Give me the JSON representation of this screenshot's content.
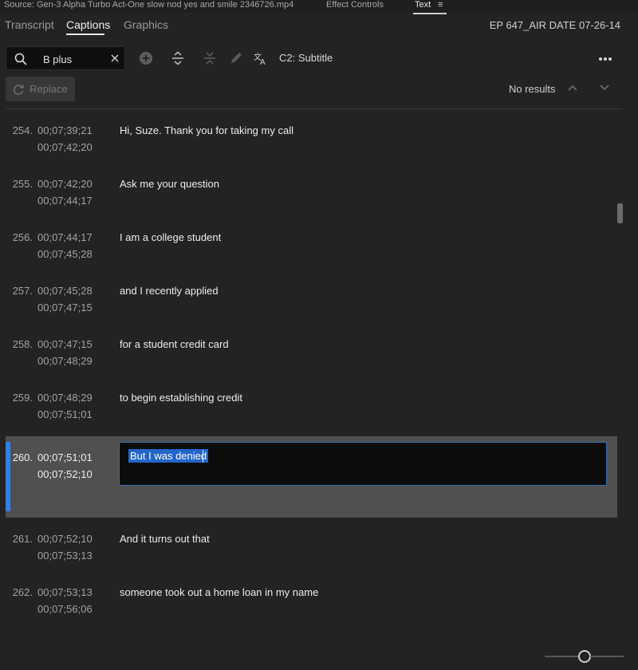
{
  "topbar": {
    "source": "Source: Gen-3 Alpha Turbo Act-One slow nod yes and smile 2346726.mp4",
    "effect_controls": "Effect Controls",
    "text_tab": "Text",
    "menu_glyph": "≡"
  },
  "tabs": [
    {
      "label": "Transcript"
    },
    {
      "label": "Captions",
      "active": true
    },
    {
      "label": "Graphics"
    }
  ],
  "sequence_title": "EP 647_AIR DATE 07-26-14",
  "toolbar": {
    "search_value": "B plus",
    "track_label": "C2: Subtitle",
    "icons": [
      "search-icon",
      "clear-icon",
      "add-caption-icon",
      "split-caption-icon",
      "merge-captions-icon",
      "pencil-icon",
      "translate-icon",
      "more-icon"
    ]
  },
  "replace": {
    "label": "Replace"
  },
  "results": {
    "label": "No results"
  },
  "captions": [
    {
      "num": "254.",
      "in": "00;07;39;21",
      "out": "00;07;42;20",
      "text": "Hi, Suze. Thank you for taking my call"
    },
    {
      "num": "255.",
      "in": "00;07;42;20",
      "out": "00;07;44;17",
      "text": "Ask me your question"
    },
    {
      "num": "256.",
      "in": "00;07;44;17",
      "out": "00;07;45;28",
      "text": "I am a college student"
    },
    {
      "num": "257.",
      "in": "00;07;45;28",
      "out": "00;07;47;15",
      "text": "and I recently applied"
    },
    {
      "num": "258.",
      "in": "00;07;47;15",
      "out": "00;07;48;29",
      "text": "for a student credit card"
    },
    {
      "num": "259.",
      "in": "00;07;48;29",
      "out": "00;07;51;01",
      "text": "to begin establishing credit"
    },
    {
      "num": "260.",
      "in": "00;07;51;01",
      "out": "00;07;52;10",
      "text": "But I was denied",
      "selected": true
    },
    {
      "num": "261.",
      "in": "00;07;52;10",
      "out": "00;07;53;13",
      "text": "And it turns out that"
    },
    {
      "num": "262.",
      "in": "00;07;53;13",
      "out": "00;07;56;06",
      "text": "someone took out a home loan in my name"
    }
  ],
  "colors": {
    "panel_bg": "#232323",
    "selection_accent": "#2f80ed",
    "selected_row_bg": "#505050",
    "text_highlight": "#2465c9"
  }
}
